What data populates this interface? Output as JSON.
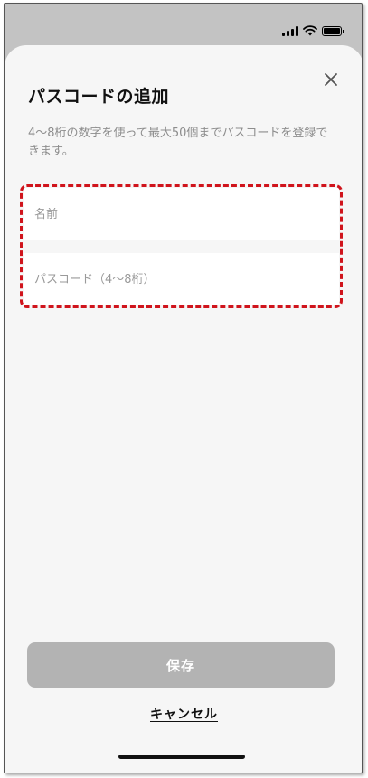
{
  "dialog": {
    "title": "パスコードの追加",
    "description": "4〜8桁の数字を使って最大50個までパスコードを登録できます。",
    "close_icon": "close-icon"
  },
  "form": {
    "name_placeholder": "名前",
    "name_value": "",
    "passcode_placeholder": "パスコード（4〜8桁）",
    "passcode_value": "",
    "highlight_color": "#d0141c"
  },
  "actions": {
    "save_label": "保存",
    "cancel_label": "キャンセル"
  },
  "status_bar": {
    "icons": [
      "signal-icon",
      "wifi-icon",
      "battery-icon"
    ]
  },
  "colors": {
    "sheet_background": "#f6f6f6",
    "disabled_button": "#b3b3b3",
    "backdrop": "#c3c3c3"
  }
}
